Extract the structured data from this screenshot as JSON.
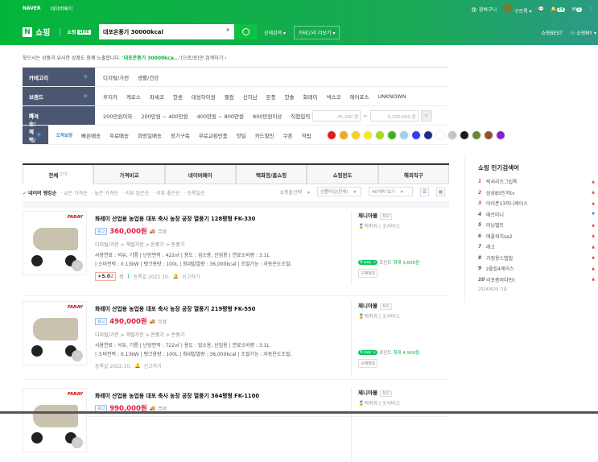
{
  "header": {
    "naver": "NAVER",
    "naverpay": "네이버페이",
    "cart": "장바구니",
    "user": "구르륵",
    "notif_count": "28",
    "mail_count": "1",
    "logo": "쇼핑",
    "live": "쇼핑",
    "live_badge": "LIVE",
    "search_value": "대포온풍기 30000kcal",
    "detail_search": "상세검색",
    "category_more": "카테고리 더보기",
    "shopping_best": "쇼핑BEST",
    "shopping_my": "쇼핑MY"
  },
  "notice": {
    "prefix": "찾으시는 상품과 유사한 상품도 함께 노출합니다. ",
    "query": "'대포온풍기 30000kca...'",
    "suffix": "(으로/로)만 검색하기 ›"
  },
  "filters": {
    "category": {
      "label": "카테고리",
      "items": [
        "디지털/가전",
        "생활/건강"
      ]
    },
    "brand": {
      "label": "브랜드",
      "items": [
        "후지카",
        "캐로스",
        "파세코",
        "한센",
        "대성하이원",
        "팰컴",
        "신지남",
        "돈풍",
        "한솔",
        "화레이",
        "넥스코",
        "에어포스",
        "UNKNOWN"
      ]
    },
    "price": {
      "label": "가격",
      "items": [
        "200만원이하",
        "200만원 ~ 400만원",
        "400만원 ~ 800만원",
        "800만원이상"
      ],
      "direct": "직접입력",
      "min": "45,290 원",
      "sep": "~",
      "max": "6,200,000 원"
    },
    "delivery": {
      "label": "배송/혜택/색상",
      "items": [
        "도착보장",
        "빠른배송",
        "무료배송",
        "희망일배송",
        "정기구독",
        "무료교환반품",
        "핫딜",
        "카드할인",
        "쿠폰",
        "적립"
      ]
    },
    "colors": [
      "#e8191b",
      "#f5a623",
      "#f5d020",
      "#f0ec1e",
      "#a6d81c",
      "#37b51a",
      "#9bd3ea",
      "#2f3ef0",
      "#1c2d86",
      "#ffffff",
      "#c4c4c4",
      "#1a1a1a",
      "#6b8530",
      "#8a5530",
      "#8a1fc8"
    ]
  },
  "tabs": [
    {
      "label": "전체",
      "count": "272"
    },
    {
      "label": "가격비교"
    },
    {
      "label": "네이버페이"
    },
    {
      "label": "백화점/홈쇼핑"
    },
    {
      "label": "쇼핑윈도"
    },
    {
      "label": "해외직구"
    }
  ],
  "sort": {
    "options": [
      "네이버 랭킹순",
      "낮은 가격순",
      "높은 가격순",
      "리뷰 많은순",
      "리뷰 좋은순",
      "등록일순"
    ],
    "mall": "쇼핑몰선택",
    "type": "상품타입(전체)",
    "per_page": "40개씩 보기"
  },
  "products": [
    {
      "brand": "FARAY",
      "title": "화레이 산업용 농업용 대포 축사 농장 공장 열풍기 128평형 FK-330",
      "ad": "광고",
      "price": "360,000원",
      "ship": "무료",
      "category": "디지털/가전 > 계절가전 > 온풍기 > 돈풍기",
      "spec1": "사용연료 : 석유, 기름 | 난방면적 : 422㎡ | 용도 : 업소용, 산업용 | 연료소비량 : 3.1L",
      "spec2": "| 소비전력 : 0.13kW | 탱크용량 : 100L | 최대발열량 : 36,000kcal | 조절기능 : 자동온도조절,",
      "rating": "5.0",
      "reviews": "2",
      "zzim_label": "찜",
      "zzim": "1",
      "date": "등록일 2022.10.",
      "report": "신고하기",
      "seller": "제니아몰",
      "seller_tag": "정보",
      "grade": "빅파워 | 굿서비스",
      "point": "포인트",
      "point_max": "최대 3,600원",
      "buyinfo": "구매정보"
    },
    {
      "brand": "FARAY",
      "title": "화레이 산업용 농업용 대포 축사 농장 공장 열풍기 219평형 FK-550",
      "ad": "광고",
      "price": "490,000원",
      "ship": "무료",
      "category": "디지털/가전 > 계절가전 > 온풍기 > 돈풍기",
      "spec1": "사용연료 : 석유, 기름 | 난방면적 : 722㎡ | 용도 : 업소용, 산업용 | 연료소비량 : 3.1L",
      "spec2": "| 소비전력 : 0.13kW | 탱크용량 : 100L | 최대발열량 : 36,000kcal | 조절기능 : 자동온도조절,",
      "date": "등록일 2022.10.",
      "report": "신고하기",
      "seller": "제니아몰",
      "seller_tag": "정보",
      "grade": "빅파워 | 굿서비스",
      "point": "포인트",
      "point_max": "최대 4,900원",
      "buyinfo": "구매정보"
    },
    {
      "brand": "FARAY",
      "title": "화레이 산업용 농업용 대포 축사 농장 공장 열풍기 364평형 FK-1100",
      "ad": "광고",
      "price": "990,000원",
      "ship": "무료",
      "seller": "제니아몰",
      "seller_tag": "정보",
      "grade": "빅파워 | 굿서비스"
    }
  ],
  "popular": {
    "title": "쇼핑 인기검색어",
    "items": [
      {
        "rank": "1",
        "text": "럭셔리즈그립톡",
        "trend": "up"
      },
      {
        "rank": "2",
        "text": "삼성85인치tv",
        "trend": "up"
      },
      {
        "rank": "3",
        "text": "아이폰13미니케이스",
        "trend": "up"
      },
      {
        "rank": "4",
        "text": "때르미니",
        "trend": "down"
      },
      {
        "rank": "5",
        "text": "러닝벨트",
        "trend": "up"
      },
      {
        "rank": "6",
        "text": "애플워치se2",
        "trend": "up"
      },
      {
        "rank": "7",
        "text": "레고",
        "trend": "up"
      },
      {
        "rank": "8",
        "text": "가정용스텝밀",
        "trend": "up"
      },
      {
        "rank": "9",
        "text": "z플립4케이스",
        "trend": "up"
      },
      {
        "rank": "10",
        "text": "리포좀비타민c",
        "trend": "up"
      }
    ],
    "date": "20240929 기준"
  }
}
